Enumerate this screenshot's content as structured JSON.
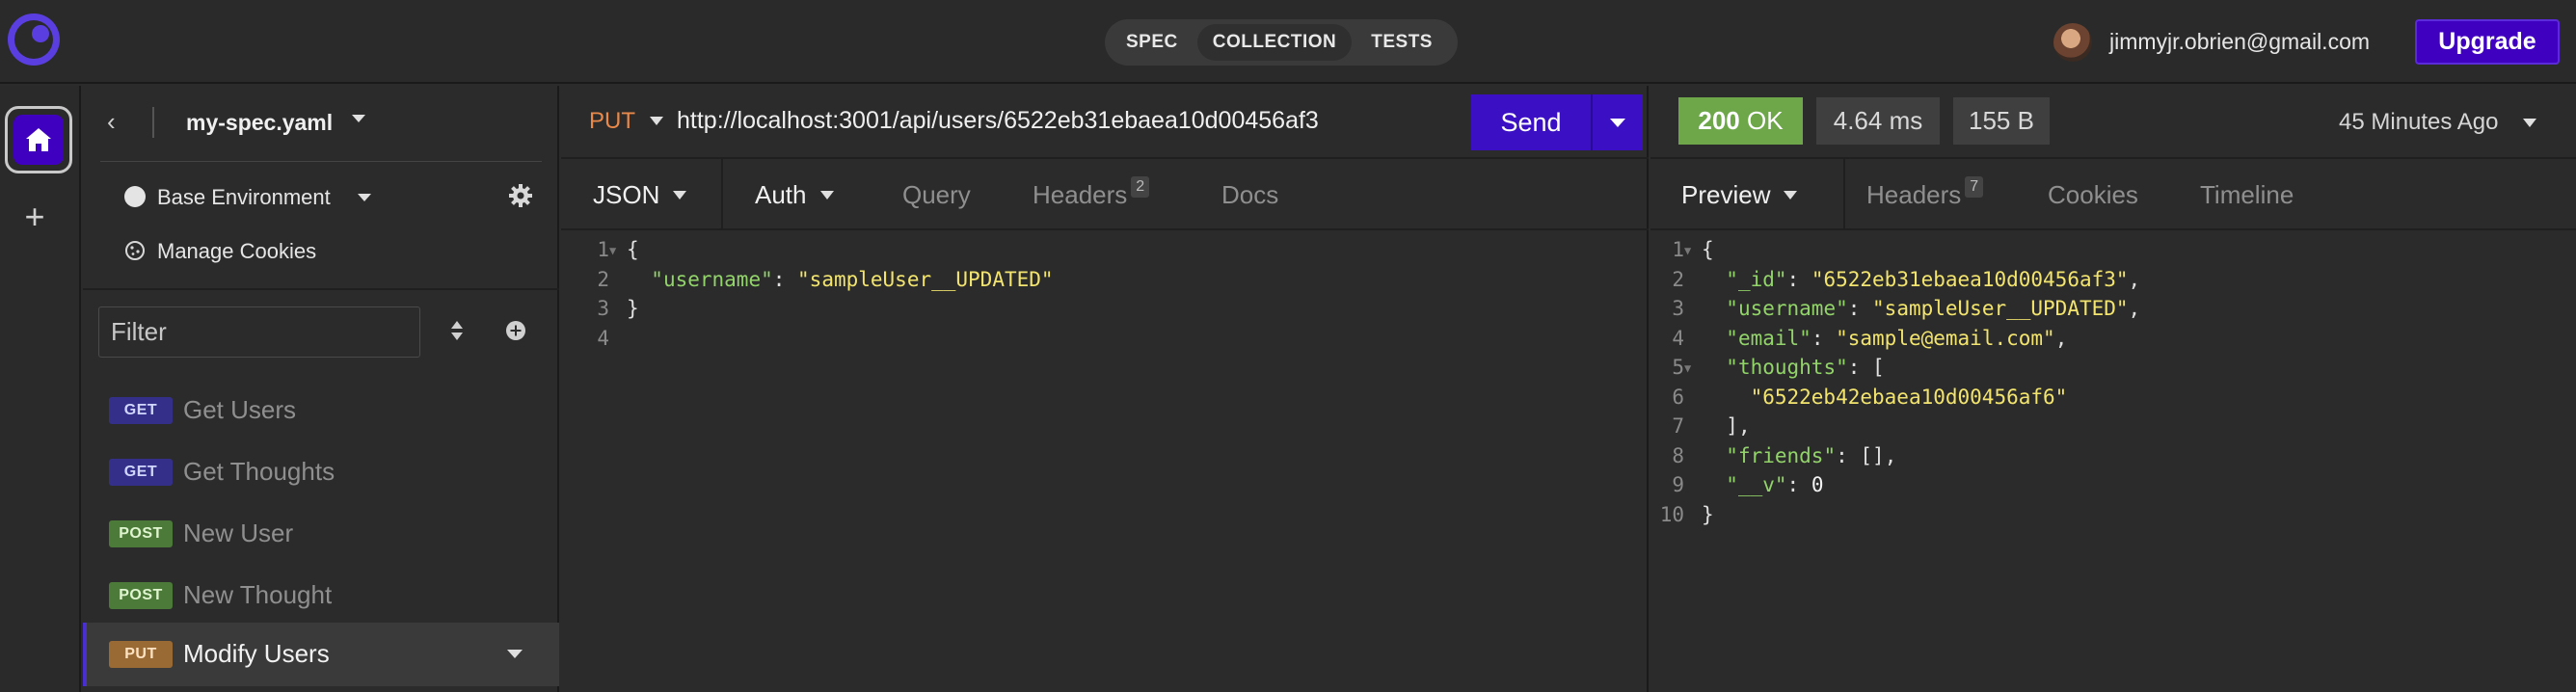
{
  "topbar": {
    "modes": [
      "SPEC",
      "COLLECTION",
      "TESTS"
    ],
    "active_mode": "COLLECTION",
    "user_email": "jimmyjr.obrien@gmail.com",
    "upgrade_label": "Upgrade"
  },
  "sidebar": {
    "spec_name": "my-spec.yaml",
    "environment": "Base Environment",
    "manage_cookies": "Manage Cookies",
    "filter_placeholder": "Filter",
    "requests": [
      {
        "method": "GET",
        "name": "Get Users"
      },
      {
        "method": "GET",
        "name": "Get Thoughts"
      },
      {
        "method": "POST",
        "name": "New User"
      },
      {
        "method": "POST",
        "name": "New Thought"
      },
      {
        "method": "PUT",
        "name": "Modify Users",
        "active": true
      }
    ]
  },
  "request": {
    "method": "PUT",
    "url": "http://localhost:3001/api/users/6522eb31ebaea10d00456af3",
    "send_label": "Send",
    "tabs": {
      "body": "JSON",
      "auth": "Auth",
      "query": "Query",
      "headers": "Headers",
      "headers_count": "2",
      "docs": "Docs"
    },
    "body_lines": [
      {
        "n": "1",
        "text": "{"
      },
      {
        "n": "2",
        "key": "\"username\"",
        "value": "\"sampleUser__UPDATED\""
      },
      {
        "n": "3",
        "text": "}"
      },
      {
        "n": "4",
        "text": ""
      }
    ]
  },
  "response": {
    "status_code": "200",
    "status_text": "OK",
    "time": "4.64 ms",
    "size": "155 B",
    "time_ago": "45 Minutes Ago",
    "tabs": {
      "preview": "Preview",
      "headers": "Headers",
      "headers_count": "7",
      "cookies": "Cookies",
      "timeline": "Timeline"
    },
    "body_lines": [
      {
        "n": "1",
        "text": "{"
      },
      {
        "n": "2",
        "key": "\"_id\"",
        "value": "\"6522eb31ebaea10d00456af3\"",
        "end": ","
      },
      {
        "n": "3",
        "key": "\"username\"",
        "value": "\"sampleUser__UPDATED\"",
        "end": ","
      },
      {
        "n": "4",
        "key": "\"email\"",
        "value": "\"sample@email.com\"",
        "end": ","
      },
      {
        "n": "5",
        "key": "\"thoughts\"",
        "value": "[",
        "end": ""
      },
      {
        "n": "6",
        "value": "\"6522eb42ebaea10d00456af6\"",
        "end": ""
      },
      {
        "n": "7",
        "text": "],"
      },
      {
        "n": "8",
        "key": "\"friends\"",
        "value": "[]",
        "end": ","
      },
      {
        "n": "9",
        "key": "\"__v\"",
        "value": "0",
        "end": ""
      },
      {
        "n": "10",
        "text": "}"
      }
    ]
  }
}
